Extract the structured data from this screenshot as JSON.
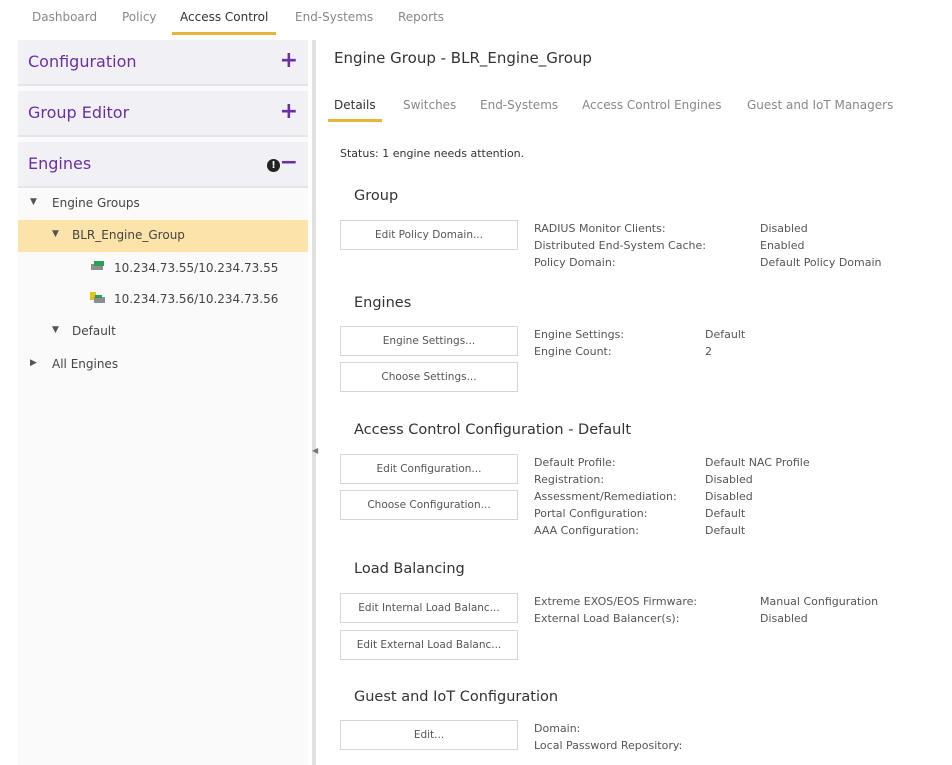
{
  "topnav": {
    "tabs": [
      "Dashboard",
      "Policy",
      "Access Control",
      "End-Systems",
      "Reports"
    ],
    "active": "Access Control"
  },
  "left": {
    "sections": {
      "configuration": {
        "title": "Configuration",
        "ctl": "+"
      },
      "group_editor": {
        "title": "Group Editor",
        "ctl": "+"
      },
      "engines": {
        "title": "Engines",
        "ctl": "−",
        "info": "!"
      }
    },
    "tree": {
      "engine_groups": "Engine Groups",
      "blr_group": "BLR_Engine_Group",
      "engine1": "10.234.73.55/10.234.73.55",
      "engine2": "10.234.73.56/10.234.73.56",
      "default": "Default",
      "all_engines": "All Engines"
    }
  },
  "right": {
    "heading": "Engine Group - BLR_Engine_Group",
    "subtabs": [
      "Details",
      "Switches",
      "End-Systems",
      "Access Control Engines",
      "Guest and IoT Managers"
    ],
    "status": "Status: 1 engine needs attention.",
    "group": {
      "title": "Group",
      "button": "Edit Policy Domain...",
      "keys": [
        "RADIUS Monitor Clients:",
        "Distributed End-System Cache:",
        "Policy Domain:"
      ],
      "values": [
        "Disabled",
        "Enabled",
        "Default Policy Domain"
      ]
    },
    "engines": {
      "title": "Engines",
      "buttons": [
        "Engine Settings...",
        "Choose Settings..."
      ],
      "keys": [
        "Engine Settings:",
        "Engine Count:"
      ],
      "values": [
        "Default",
        "2"
      ]
    },
    "acc": {
      "title": "Access Control Configuration - Default",
      "buttons": [
        "Edit Configuration...",
        "Choose Configuration..."
      ],
      "keys": [
        "Default Profile:",
        "Registration:",
        "Assessment/Remediation:",
        "Portal Configuration:",
        "AAA Configuration:"
      ],
      "values": [
        "Default NAC Profile",
        "Disabled",
        "Disabled",
        "Default",
        "Default"
      ]
    },
    "lb": {
      "title": "Load Balancing",
      "buttons": [
        "Edit Internal Load Balanc...",
        "Edit External Load Balanc..."
      ],
      "keys": [
        "Extreme EXOS/EOS Firmware:",
        "External Load Balancer(s):"
      ],
      "values": [
        "Manual Configuration",
        "Disabled"
      ]
    },
    "guest": {
      "title": "Guest and IoT Configuration",
      "button": "Edit...",
      "keys": [
        "Domain:",
        "Local Password Repository:"
      ]
    }
  },
  "colors": {
    "accent_purple": "#6a2fa6",
    "accent_gold": "#e8b43a",
    "selected_row": "#fbe3a9"
  }
}
